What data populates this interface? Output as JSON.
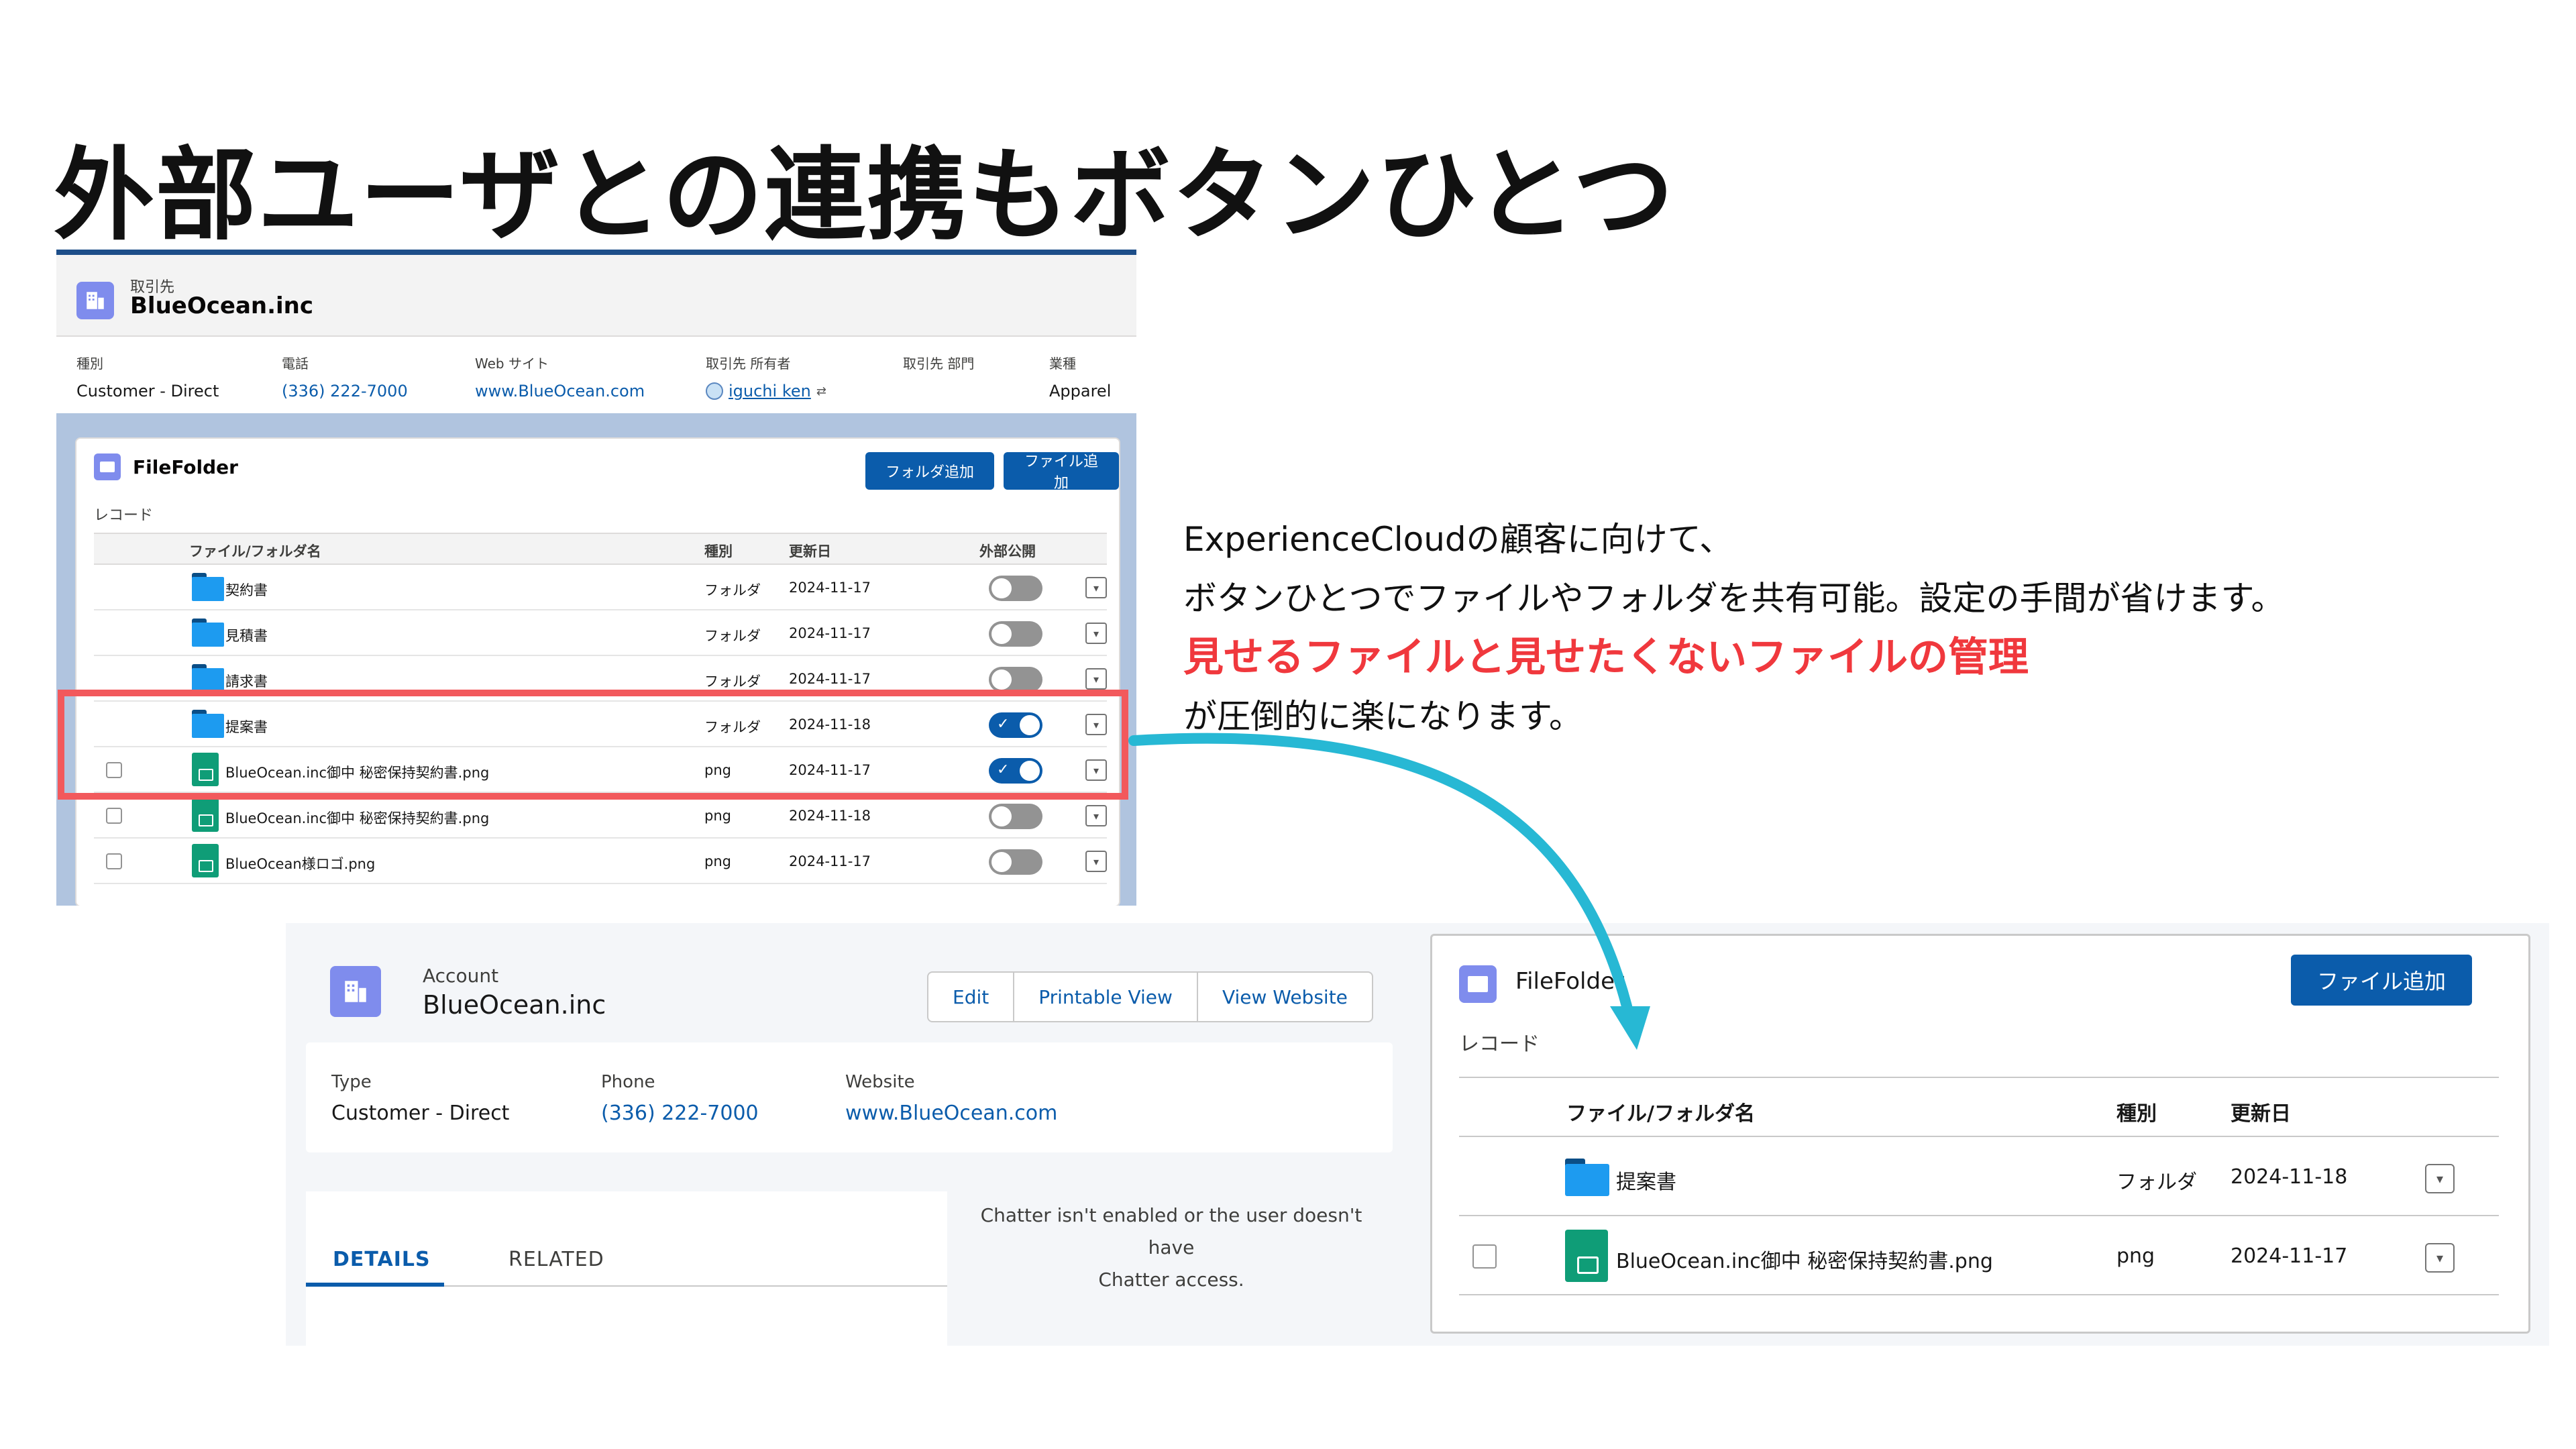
{
  "headline": "外部ユーザとの連携もボタンひとつ",
  "internal": {
    "object_label": "取引先",
    "record_name": "BlueOcean.inc",
    "highlights": [
      {
        "label": "種別",
        "value": "Customer - Direct"
      },
      {
        "label": "電話",
        "value": "(336) 222-7000"
      },
      {
        "label": "Web サイト",
        "value": "www.BlueOcean.com"
      },
      {
        "label": "取引先 所有者",
        "value": "iguchi ken"
      },
      {
        "label": "取引先 部門",
        "value": ""
      },
      {
        "label": "業種",
        "value": "Apparel"
      }
    ],
    "card": {
      "title": "FileFolder",
      "subtitle": "レコード",
      "add_folder_button": "フォルダ追加",
      "add_file_button": "ファイル追加",
      "columns": [
        "ファイル/フォルダ名",
        "種別",
        "更新日",
        "外部公開"
      ],
      "rows": [
        {
          "name": "契約書",
          "kind": "フォルダ",
          "date": "2024-11-17",
          "public": false,
          "icon": "folder-icon",
          "checkbox": false
        },
        {
          "name": "見積書",
          "kind": "フォルダ",
          "date": "2024-11-17",
          "public": false,
          "icon": "folder-icon",
          "checkbox": false
        },
        {
          "name": "請求書",
          "kind": "フォルダ",
          "date": "2024-11-17",
          "public": false,
          "icon": "folder-icon",
          "checkbox": false
        },
        {
          "name": "提案書",
          "kind": "フォルダ",
          "date": "2024-11-18",
          "public": true,
          "icon": "folder-icon",
          "checkbox": false
        },
        {
          "name": "BlueOcean.inc御中 秘密保持契約書.png",
          "kind": "png",
          "date": "2024-11-17",
          "public": true,
          "icon": "image-file-icon",
          "checkbox": true
        },
        {
          "name": "BlueOcean.inc御中 秘密保持契約書.png",
          "kind": "png",
          "date": "2024-11-18",
          "public": false,
          "icon": "image-file-icon",
          "checkbox": true
        },
        {
          "name": "BlueOcean様ロゴ.png",
          "kind": "png",
          "date": "2024-11-17",
          "public": false,
          "icon": "image-file-icon",
          "checkbox": true
        }
      ]
    }
  },
  "description": {
    "line1": "ExperienceCloudの顧客に向けて、",
    "line2": "ボタンひとつでファイルやフォルダを共有可能。設定の手間が省けます。",
    "line3_emphasis": "見せるファイルと見せたくないファイルの管理",
    "line4": "が圧倒的に楽になります。"
  },
  "external": {
    "object_label": "Account",
    "record_name": "BlueOcean.inc",
    "buttons": [
      "Edit",
      "Printable View",
      "View Website"
    ],
    "fields": [
      {
        "label": "Type",
        "value": "Customer - Direct"
      },
      {
        "label": "Phone",
        "value": "(336) 222-7000"
      },
      {
        "label": "Website",
        "value": "www.BlueOcean.com"
      }
    ],
    "tabs": [
      "DETAILS",
      "RELATED"
    ],
    "chatter_line1": "Chatter isn't enabled or the user doesn't have",
    "chatter_line2": "Chatter access.",
    "card": {
      "title": "FileFolder",
      "subtitle": "レコード",
      "add_file_button": "ファイル追加",
      "columns": [
        "ファイル/フォルダ名",
        "種別",
        "更新日"
      ],
      "rows": [
        {
          "name": "提案書",
          "kind": "フォルダ",
          "date": "2024-11-18"
        },
        {
          "name": "BlueOcean.inc御中 秘密保持契約書.png",
          "kind": "png",
          "date": "2024-11-17"
        }
      ]
    }
  },
  "colors": {
    "highlight": "#f2595c",
    "arrow": "#27b8d4",
    "brand_blue": "#0b5cab",
    "emphasis_red": "#f0383d"
  }
}
